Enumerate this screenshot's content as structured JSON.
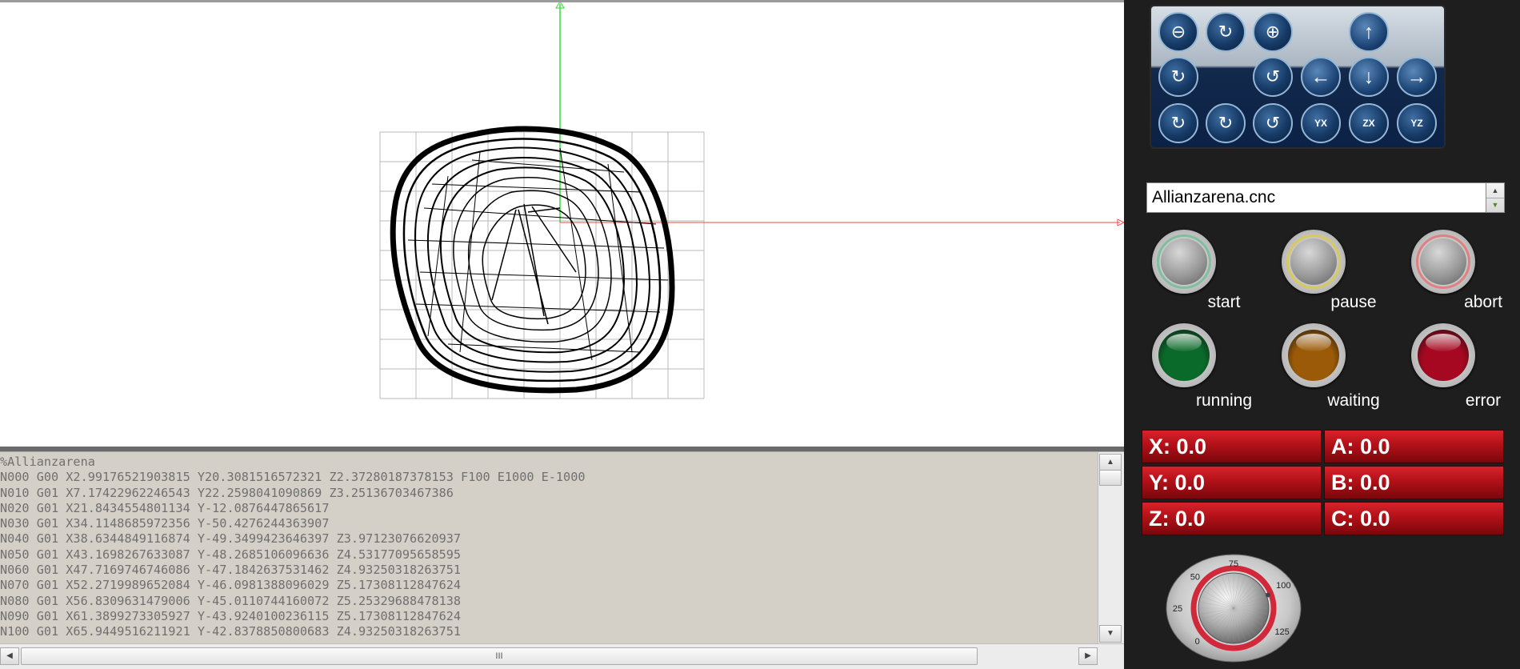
{
  "viewport": {
    "axes": {
      "x_color": "#ff4040",
      "y_color": "#33dd33"
    }
  },
  "gcode": {
    "lines": [
      "%Allianzarena",
      "N000 G00 X2.99176521903815 Y20.3081516572321 Z2.37280187378153 F100 E1000 E-1000",
      "N010 G01 X7.17422962246543 Y22.2598041090869 Z3.25136703467386",
      "N020 G01 X21.8434554801134 Y-12.0876447865617",
      "N030 G01 X34.1148685972356 Y-50.4276244363907",
      "N040 G01 X38.6344849116874 Y-49.3499423646397 Z3.97123076620937",
      "N050 G01 X43.1698267633087 Y-48.2685106096636 Z4.53177095658595",
      "N060 G01 X47.7169746746086 Y-47.1842637531462 Z4.93250318263751",
      "N070 G01 X52.2719989652084 Y-46.0981388096029 Z5.17308112847624",
      "N080 G01 X56.8309631479006 Y-45.0110744160072 Z5.25329688478138",
      "N090 G01 X61.3899273305927 Y-43.9240100236115 Z5.17308112847624",
      "N100 G01 X65.9449516211921 Y-42.8378850800683 Z4.93250318263751"
    ],
    "hscroll_grip": "III"
  },
  "toolbar": {
    "buttons": [
      {
        "icon": "zoom-out-icon",
        "glyph": "⊖"
      },
      {
        "icon": "rotate-icon",
        "glyph": "↻"
      },
      {
        "icon": "zoom-in-icon",
        "glyph": "⊕"
      },
      {
        "icon": "pan-up-icon",
        "glyph": "↑"
      },
      {
        "icon": "rotate-cw-icon",
        "glyph": "↻"
      },
      {
        "icon": "rotate-ccw-icon",
        "glyph": "↺"
      },
      {
        "icon": "pan-left-icon",
        "glyph": "←"
      },
      {
        "icon": "pan-down-icon",
        "glyph": "↓"
      },
      {
        "icon": "pan-right-icon",
        "glyph": "→"
      },
      {
        "icon": "roll-cw-icon",
        "glyph": "↻"
      },
      {
        "icon": "roll-icon",
        "glyph": "↻"
      },
      {
        "icon": "roll-ccw-icon",
        "glyph": "↺"
      },
      {
        "icon": "view-xy-icon",
        "glyph": "YX"
      },
      {
        "icon": "view-zx-icon",
        "glyph": "ZX"
      },
      {
        "icon": "view-yz-icon",
        "glyph": "YZ"
      }
    ]
  },
  "file": {
    "name": "Allianzarena.cnc"
  },
  "controls": {
    "start": "start",
    "pause": "pause",
    "abort": "abort",
    "start_color": "#7fbfa0",
    "pause_color": "#d8c860",
    "abort_color": "#e08080"
  },
  "status": {
    "running": "running",
    "waiting": "waiting",
    "error": "error",
    "running_color": "#0a6a2a",
    "waiting_color": "#9a5a08",
    "error_color": "#a50820"
  },
  "dro": {
    "x": "X: 0.0",
    "y": "Y: 0.0",
    "z": "Z: 0.0",
    "a": "A: 0.0",
    "b": "B: 0.0",
    "c": "C: 0.0"
  },
  "knob": {
    "ticks": [
      "0",
      "25",
      "50",
      "75",
      "100",
      "125"
    ],
    "value": 100
  }
}
